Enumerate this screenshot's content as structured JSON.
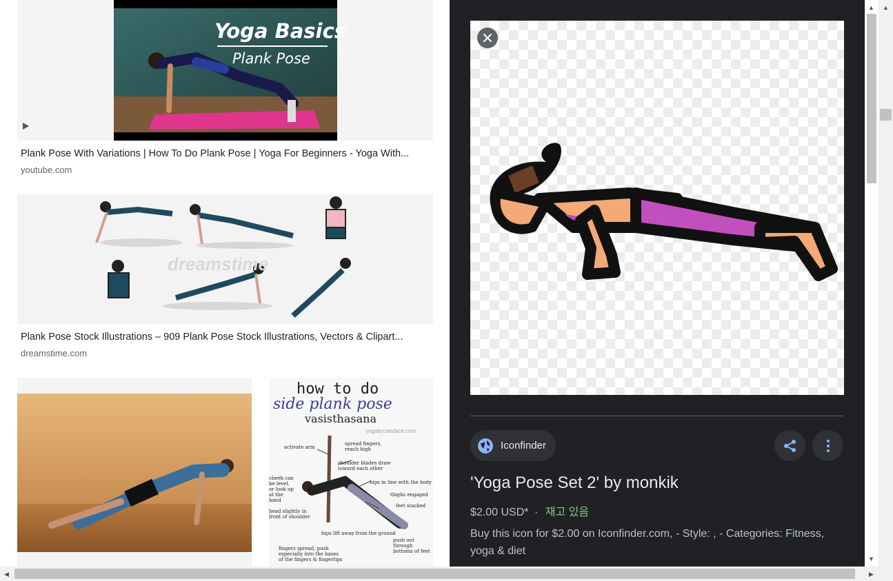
{
  "results": [
    {
      "title": "Plank Pose With Variations | How To Do Plank Pose | Yoga For Beginners - Yoga With...",
      "source": "youtube.com",
      "thumb_text_line1": "Yoga Basics",
      "thumb_text_line2": "Plank Pose",
      "is_video": true
    },
    {
      "title": "Plank Pose Stock Illustrations – 909 Plank Pose Stock Illustrations, Vectors & Clipart...",
      "source": "dreamstime.com",
      "watermark": "dreamstime"
    },
    {
      "infographic_line1": "how to do",
      "infographic_line2": "side plank pose",
      "infographic_line3": "vasisthasana",
      "infographic_site": "yogabycandace.com",
      "notes": [
        "activate arm",
        "spread fingers, reach high",
        "shoulder blades draw toward each other",
        "hips in line with the body",
        "thighs engaged",
        "feet stacked",
        "cheek can be level, or look up at the hand",
        "head slightly in front of shoulder",
        "hips lift away from the ground",
        "push out through bottoms of feet",
        "fingers spread, push especially into the bases of the fingers & fingertips"
      ]
    }
  ],
  "preview": {
    "source_name": "Iconfinder",
    "title": "'Yoga Pose Set 2' by monkik",
    "price": "$2.00 USD*",
    "separator": "·",
    "stock": "재고 있음",
    "description": "Buy this icon for $2.00 on Iconfinder.com, - Style: , - Categories: Fitness, yoga & diet"
  },
  "colors": {
    "panel_bg": "#202124",
    "chip_bg": "#303134",
    "accent_blue": "#8ab4f8",
    "stock_green": "#81c995"
  }
}
